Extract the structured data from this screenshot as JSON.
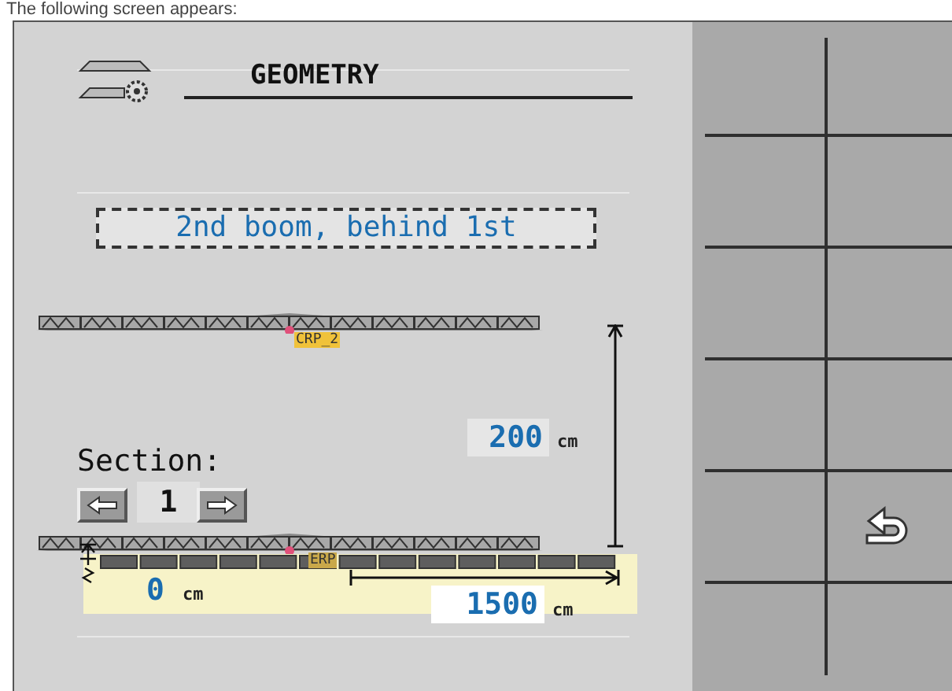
{
  "caption": "The following screen appears:",
  "header": {
    "title": "GEOMETRY"
  },
  "mode": {
    "label": "2nd boom, behind 1st"
  },
  "top_boom": {
    "label": "CRP_2"
  },
  "height": {
    "value": "200",
    "unit": "cm"
  },
  "section": {
    "label": "Section:",
    "value": "1"
  },
  "bottom_boom": {
    "label": "ERP"
  },
  "offset": {
    "value": "0",
    "unit": "cm"
  },
  "width": {
    "value": "1500",
    "unit": "cm"
  },
  "softkeys": [
    {
      "kind": "empty"
    },
    {
      "kind": "empty"
    },
    {
      "kind": "empty"
    },
    {
      "kind": "empty"
    },
    {
      "kind": "empty"
    },
    {
      "kind": "empty"
    },
    {
      "kind": "empty"
    },
    {
      "kind": "empty"
    },
    {
      "kind": "empty"
    },
    {
      "kind": "back"
    },
    {
      "kind": "empty"
    },
    {
      "kind": "empty"
    }
  ]
}
